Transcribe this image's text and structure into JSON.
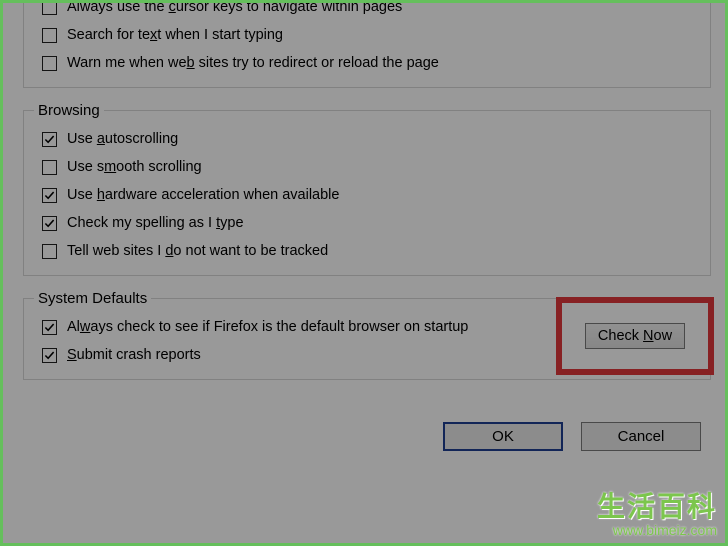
{
  "general": {
    "items": [
      {
        "label_html": "Always use the <span class=\"ul\">c</span>ursor keys to navigate within pages",
        "checked": false
      },
      {
        "label_html": "Search for te<span class=\"ul\">x</span>t when I start typing",
        "checked": false
      },
      {
        "label_html": "Warn me when we<span class=\"ul\">b</span> sites try to redirect or reload the page",
        "checked": false
      }
    ]
  },
  "browsing": {
    "legend": "Browsing",
    "items": [
      {
        "label_html": "Use <span class=\"ul\">a</span>utoscrolling",
        "checked": true
      },
      {
        "label_html": "Use s<span class=\"ul\">m</span>ooth scrolling",
        "checked": false
      },
      {
        "label_html": "Use <span class=\"ul\">h</span>ardware acceleration when available",
        "checked": true
      },
      {
        "label_html": "Check my spelling as I <span class=\"ul\">t</span>ype",
        "checked": true
      },
      {
        "label_html": "Tell web sites I <span class=\"ul\">d</span>o not want to be tracked",
        "checked": false
      }
    ]
  },
  "system_defaults": {
    "legend": "System Defaults",
    "items": [
      {
        "label_html": "Al<span class=\"ul\">w</span>ays check to see if Firefox is the default browser on startup",
        "checked": true
      },
      {
        "label_html": "<span class=\"ul\">S</span>ubmit crash reports",
        "checked": true
      }
    ],
    "check_now_html": "Check <span class=\"ul\">N</span>ow"
  },
  "buttons": {
    "ok": "OK",
    "cancel": "Cancel"
  },
  "watermark": {
    "title": "生活百科",
    "url": "www.bimeiz.com"
  }
}
